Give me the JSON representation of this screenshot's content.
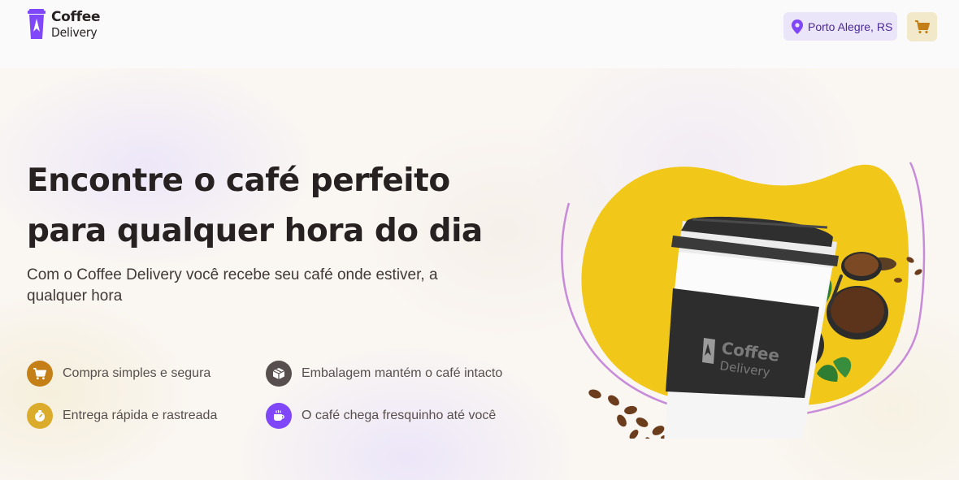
{
  "app": {
    "logo_title": "Coffee",
    "logo_subtitle": "Delivery"
  },
  "header": {
    "location": "Porto Alegre, RS",
    "location_icon": "map-pin-icon",
    "cart_icon": "shopping-cart-icon"
  },
  "hero": {
    "title_line1": "Encontre o café perfeito",
    "title_line2": "para qualquer hora do dia",
    "subtitle": "Com o Coffee Delivery você recebe seu café onde estiver, a qualquer hora",
    "cup_brand_title": "Coffee",
    "cup_brand_subtitle": "Delivery",
    "features": [
      {
        "label": "Compra simples e segura",
        "icon": "shopping-cart-icon",
        "color": "#c47f17"
      },
      {
        "label": "Embalagem mantém o café intacto",
        "icon": "package-icon",
        "color": "#574f4d"
      },
      {
        "label": "Entrega rápida e rastreada",
        "icon": "timer-icon",
        "color": "#dbac2c"
      },
      {
        "label": "O café chega fresquinho até você",
        "icon": "coffee-icon",
        "color": "#8047f8"
      }
    ]
  },
  "colors": {
    "purple": "#8047f8",
    "purple_dark": "#4b2995",
    "purple_light": "#ebe5f9",
    "yellow": "#dbac2c",
    "yellow_dark": "#c47f17",
    "yellow_light": "#f1e9c9",
    "text_title": "#272221"
  }
}
